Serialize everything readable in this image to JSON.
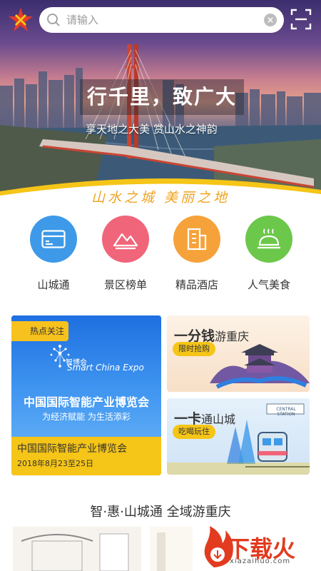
{
  "search": {
    "placeholder": "请输入",
    "clear_icon": "×"
  },
  "hero": {
    "title": "行千里，致广大",
    "subtitle": "享天地之大美 赏山水之神韵",
    "slogan": "山水之城 美丽之地"
  },
  "categories": [
    {
      "label": "山城通",
      "icon": "card-icon",
      "color": "#3e9ae8"
    },
    {
      "label": "景区榜单",
      "icon": "mountain-icon",
      "color": "#f0657a"
    },
    {
      "label": "精品酒店",
      "icon": "building-icon",
      "color": "#f6a23a"
    },
    {
      "label": "人气美食",
      "icon": "food-cloche-icon",
      "color": "#6cc84a"
    }
  ],
  "promo_main": {
    "tag": "热点关注",
    "expo_cn": "智博会",
    "expo_en": "Smart China Expo",
    "headline": "中国国际智能产业博览会",
    "subline": "为经济赋能 为生活添彩",
    "title": "中国国际智能产业博览会",
    "date": "2018年8月23至25日"
  },
  "promo_side": [
    {
      "title_bold": "一分钱",
      "title_rest": "游重庆",
      "pill": "限时抢购"
    },
    {
      "title_bold": "一卡",
      "title_rest": "通山城",
      "pill": "吃喝玩住",
      "sign": "CENTRAL STATION"
    }
  ],
  "section": {
    "title": "智·惠·山城通 全域游重庆"
  },
  "watermark": {
    "text": "下载火",
    "url": "xiazaihuo.com"
  },
  "colors": {
    "accent": "#f5c517",
    "blue": "#2f7fe0"
  }
}
